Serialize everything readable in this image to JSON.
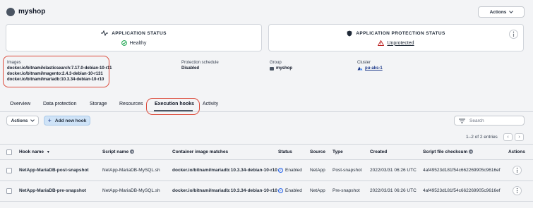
{
  "app": {
    "title": "myshop",
    "actions_label": "Actions"
  },
  "application_status": {
    "heading": "APPLICATION STATUS",
    "value": "Healthy"
  },
  "protection_status": {
    "heading": "APPLICATION PROTECTION STATUS",
    "value": "Unprotected"
  },
  "meta": {
    "images_label": "Images",
    "images": [
      "docker.io/bitnami/elasticsearch:7.17.0-debian-10-r11",
      "docker.io/bitnami/magento:2.4.3-debian-10-r131",
      "docker.io/bitnami/mariadb:10.3.34-debian-10-r10"
    ],
    "schedule_label": "Protection schedule",
    "schedule_value": "Disabled",
    "group_label": "Group",
    "group_value": "myshop",
    "cluster_label": "Cluster",
    "cluster_value": "pu-aks-1"
  },
  "tabs": [
    "Overview",
    "Data protection",
    "Storage",
    "Resources",
    "Execution hooks",
    "Activity"
  ],
  "active_tab": "Execution hooks",
  "toolbar": {
    "actions_label": "Actions",
    "add_label": "Add new hook",
    "search_placeholder": "Search"
  },
  "pagination": {
    "text": "1–2 of 2 entries"
  },
  "table": {
    "columns": [
      "Hook name",
      "Script name",
      "Container image matches",
      "Status",
      "Source",
      "Type",
      "Created",
      "Script file checksum",
      "Actions"
    ],
    "rows": [
      {
        "hook_name": "NetApp-MariaDB-post-snapshot",
        "script_name": "NetApp-MariaDB-MySQL.sh",
        "image": "docker.io/bitnami/mariadb:10.3.34-debian-10-r10",
        "status": "Enabled",
        "source": "NetApp",
        "type": "Post-snapshot",
        "created": "2022/03/31 06:26 UTC",
        "checksum": "4af49523d181f54c662269905c9616ef"
      },
      {
        "hook_name": "NetApp-MariaDB-pre-snapshot",
        "script_name": "NetApp-MariaDB-MySQL.sh",
        "image": "docker.io/bitnami/mariadb:10.3.34-debian-10-r10",
        "status": "Enabled",
        "source": "NetApp",
        "type": "Pre-snapshot",
        "created": "2022/03/31 06:26 UTC",
        "checksum": "4af49523d181f54c662269905c9616ef"
      }
    ]
  },
  "colors": {
    "highlight": "#dc4a3a",
    "healthy": "#16a34a",
    "warning": "#b91c1c",
    "enabled": "#2563eb"
  }
}
